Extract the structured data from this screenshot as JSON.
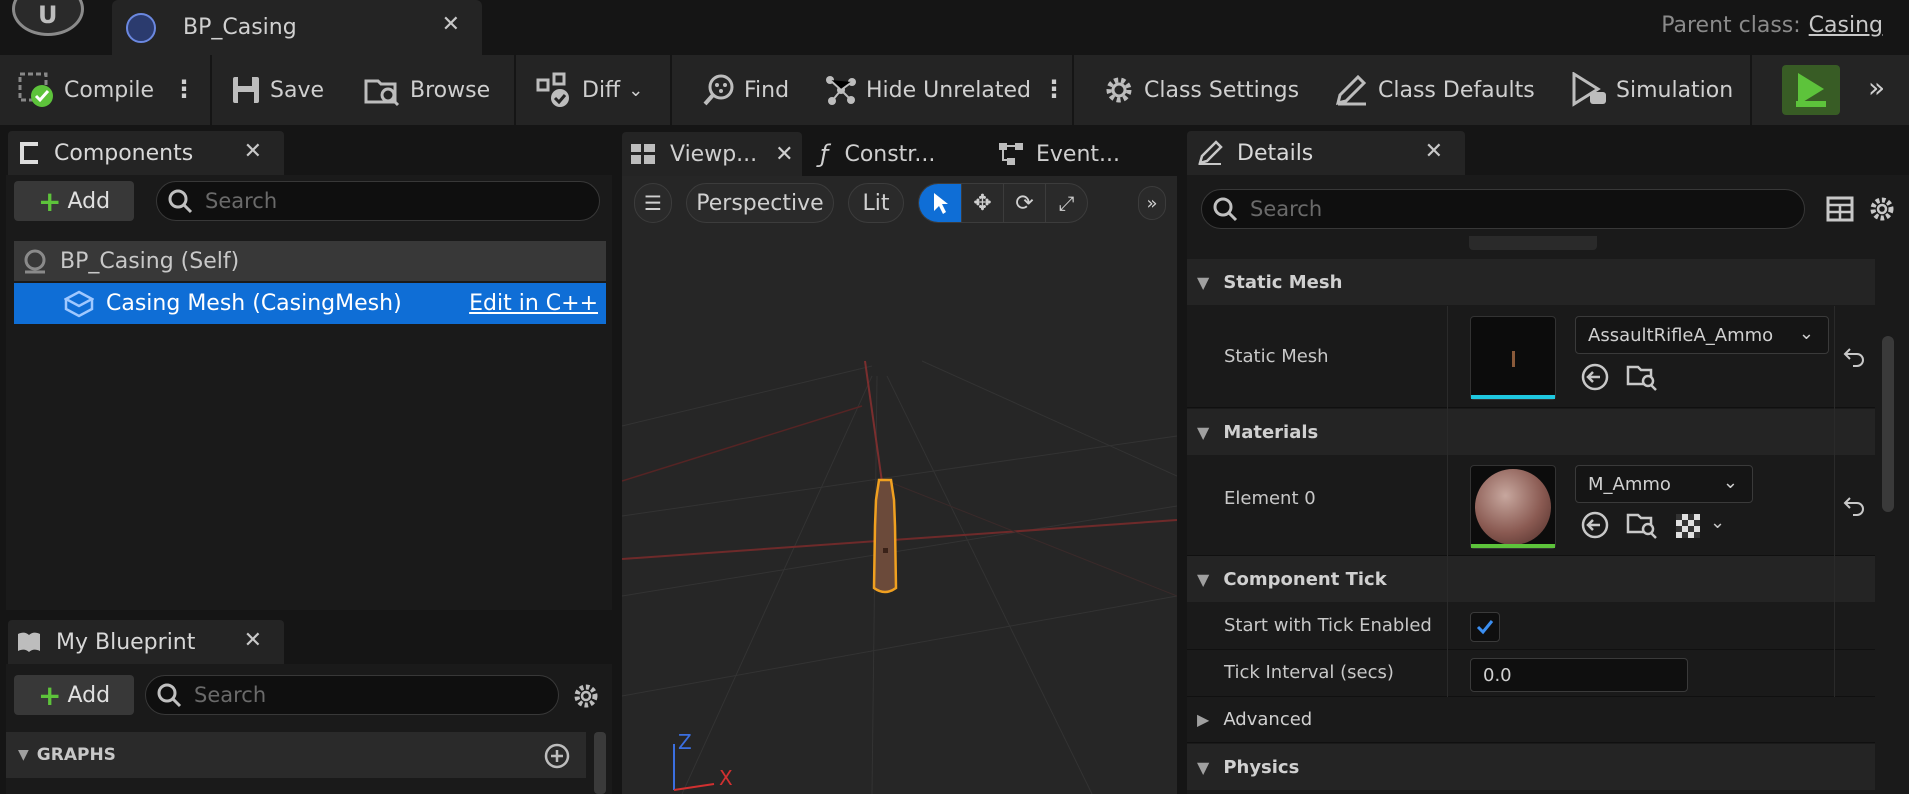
{
  "window": {
    "tab_title": "BP_Casing",
    "parent_class_label": "Parent class:",
    "parent_class_value": "Casing"
  },
  "toolbar": {
    "compile": "Compile",
    "save": "Save",
    "browse": "Browse",
    "diff": "Diff",
    "find": "Find",
    "hide_unrelated": "Hide Unrelated",
    "class_settings": "Class Settings",
    "class_defaults": "Class Defaults",
    "simulation": "Simulation"
  },
  "components": {
    "tab": "Components",
    "add": "Add",
    "search_placeholder": "Search",
    "root": "BP_Casing (Self)",
    "selected_item": "Casing Mesh (CasingMesh)",
    "edit_link": "Edit in C++"
  },
  "my_blueprint": {
    "tab": "My Blueprint",
    "add": "Add",
    "search_placeholder": "Search",
    "section": "GRAPHS"
  },
  "viewport": {
    "tabs": [
      "Viewp...",
      "Constr...",
      "Event..."
    ],
    "view_mode": "Perspective",
    "lighting": "Lit",
    "axis_z": "Z",
    "axis_x": "X"
  },
  "details": {
    "tab": "Details",
    "search_placeholder": "Search",
    "sections": {
      "static_mesh": "Static Mesh",
      "materials": "Materials",
      "component_tick": "Component Tick",
      "advanced": "Advanced",
      "physics": "Physics"
    },
    "static_mesh_label": "Static Mesh",
    "static_mesh_value": "AssaultRifleA_Ammo",
    "element0_label": "Element 0",
    "element0_value": "M_Ammo",
    "tick_enabled_label": "Start with Tick Enabled",
    "tick_enabled": true,
    "tick_interval_label": "Tick Interval (secs)",
    "tick_interval_value": "0.0"
  },
  "colors": {
    "accent": "#0f6ed6",
    "selected_row": "#0f6ed6",
    "play_green": "#5dc33b",
    "mesh_bar": "#1fc8e0",
    "mat_bar": "#5dc33b"
  }
}
